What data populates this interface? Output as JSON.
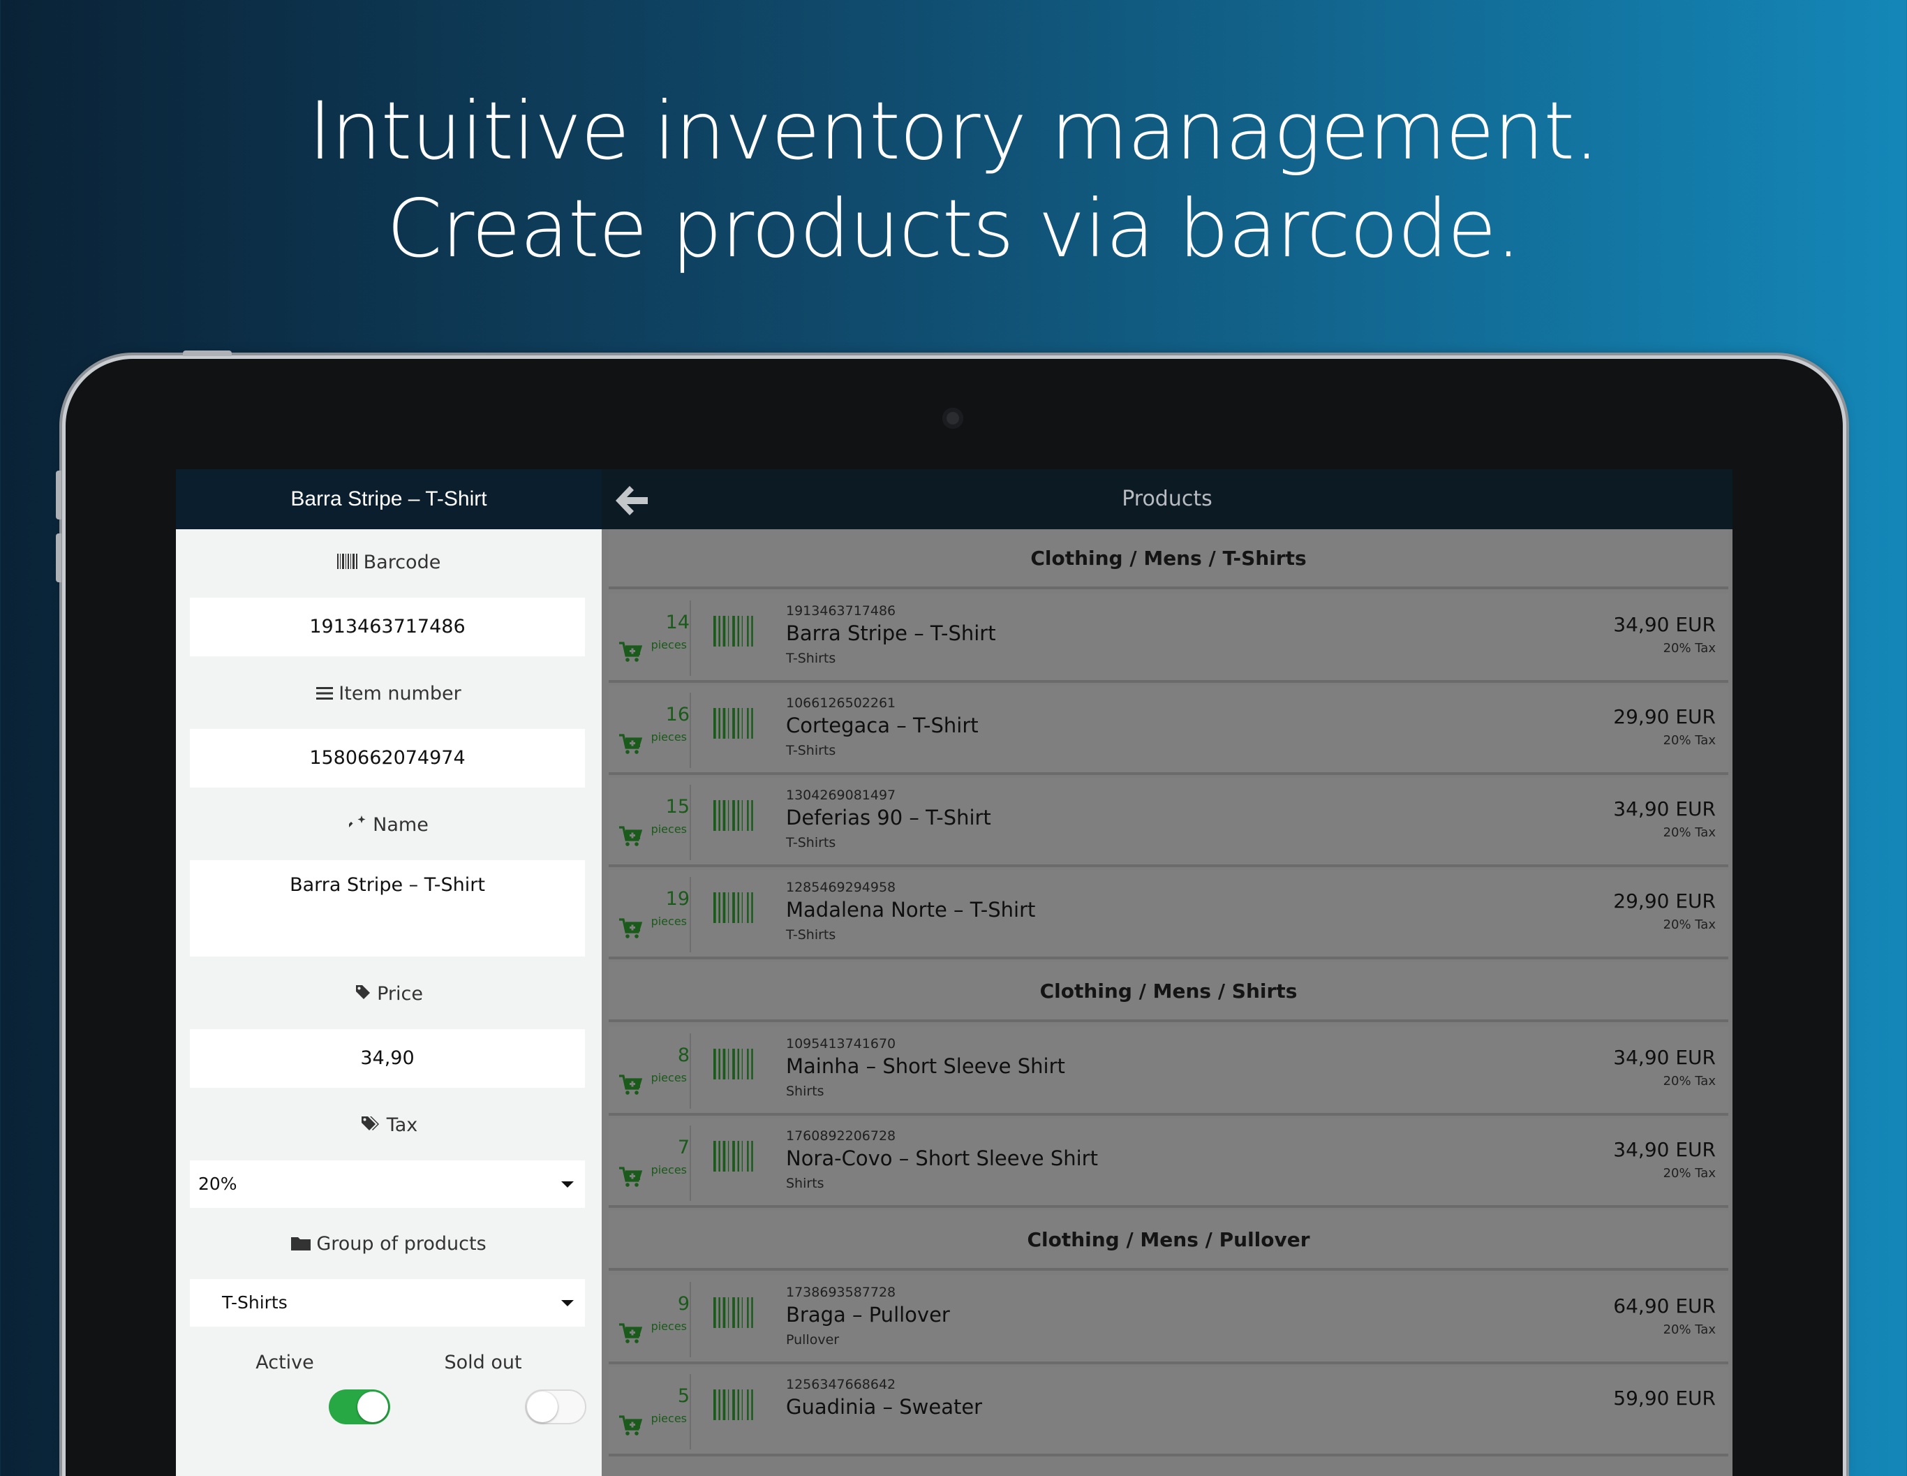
{
  "headline": {
    "line1": "Intuitive inventory management.",
    "line2": "Create products via barcode."
  },
  "colors": {
    "background_left": "#0a2236",
    "background_right": "#1487b8",
    "header_dark": "#0b1e2e",
    "stock_green": "#1a5a1a",
    "toggle_active": "#27a844"
  },
  "left_pane": {
    "title": "Barra Stripe – T-Shirt",
    "barcode_label": "Barcode",
    "barcode_value": "1913463717486",
    "item_number_label": "Item number",
    "item_number_value": "1580662074974",
    "name_label": "Name",
    "name_value": "Barra Stripe – T-Shirt",
    "price_label": "Price",
    "price_value": "34,90",
    "tax_label": "Tax",
    "tax_selected": "20%",
    "group_label": "Group of products",
    "group_selected": "T-Shirts",
    "active_label": "Active",
    "active_on": true,
    "sold_out_label": "Sold out",
    "sold_out_on": false
  },
  "right_pane": {
    "title": "Products",
    "pieces_label": "pieces",
    "groups": [
      {
        "title": "Clothing / Mens / T-Shirts",
        "items": [
          {
            "stock": "14",
            "code": "1913463717486",
            "name": "Barra Stripe – T-Shirt",
            "group": "T-Shirts",
            "price": "34,90 EUR",
            "tax": "20% Tax"
          },
          {
            "stock": "16",
            "code": "1066126502261",
            "name": "Cortegaca – T-Shirt",
            "group": "T-Shirts",
            "price": "29,90 EUR",
            "tax": "20% Tax"
          },
          {
            "stock": "15",
            "code": "1304269081497",
            "name": "Deferias 90 – T-Shirt",
            "group": "T-Shirts",
            "price": "34,90 EUR",
            "tax": "20% Tax"
          },
          {
            "stock": "19",
            "code": "1285469294958",
            "name": "Madalena Norte – T-Shirt",
            "group": "T-Shirts",
            "price": "29,90 EUR",
            "tax": "20% Tax"
          }
        ]
      },
      {
        "title": "Clothing / Mens / Shirts",
        "items": [
          {
            "stock": "8",
            "code": "1095413741670",
            "name": "Mainha – Short Sleeve Shirt",
            "group": "Shirts",
            "price": "34,90 EUR",
            "tax": "20% Tax"
          },
          {
            "stock": "7",
            "code": "1760892206728",
            "name": "Nora-Covo – Short Sleeve Shirt",
            "group": "Shirts",
            "price": "34,90 EUR",
            "tax": "20% Tax"
          }
        ]
      },
      {
        "title": "Clothing / Mens / Pullover",
        "items": [
          {
            "stock": "9",
            "code": "1738693587728",
            "name": "Braga – Pullover",
            "group": "Pullover",
            "price": "64,90 EUR",
            "tax": "20% Tax"
          },
          {
            "stock": "5",
            "code": "1256347668642",
            "name": "Guadinia – Sweater",
            "group": "",
            "price": "59,90 EUR",
            "tax": ""
          }
        ]
      }
    ]
  },
  "icons": {
    "barcode": "barcode-icon",
    "item_number": "list-icon",
    "name": "magic-wand-icon",
    "price": "tag-icon",
    "tax": "tags-icon",
    "group": "folder-icon",
    "back": "arrow-left-icon",
    "cart": "cart-plus-icon",
    "product_barcode": "barcode-icon"
  }
}
